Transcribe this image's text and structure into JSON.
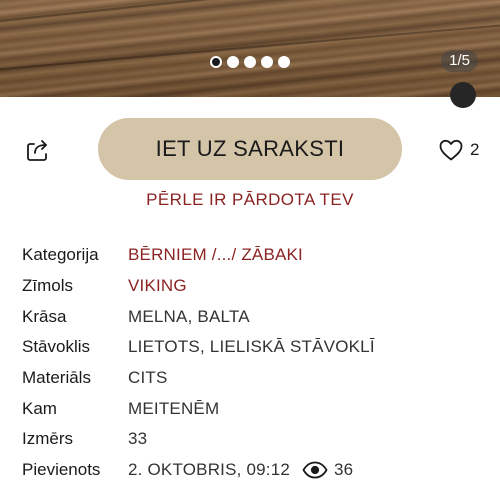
{
  "gallery": {
    "dots_total": 5,
    "active_index": 0,
    "counter": "1/5"
  },
  "actions": {
    "share_icon": "share-icon",
    "primary_label": "IET UZ SARAKSTI",
    "favorite_icon": "heart-icon",
    "favorite_count": "2"
  },
  "status": {
    "sold_note": "PĒRLE IR PĀRDOTA TEV"
  },
  "details": {
    "category": {
      "label": "Kategorija",
      "value": "BĒRNIEM /.../ ZĀBAKI"
    },
    "brand": {
      "label": "Zīmols",
      "value": "VIKING"
    },
    "color": {
      "label": "Krāsa",
      "value": "MELNA, BALTA"
    },
    "condition": {
      "label": "Stāvoklis",
      "value": "LIETOTS, LIELISKĀ STĀVOKLĪ"
    },
    "material": {
      "label": "Materiāls",
      "value": "CITS"
    },
    "audience": {
      "label": "Kam",
      "value": "MEITENĒM"
    },
    "size": {
      "label": "Izmērs",
      "value": "33"
    },
    "added": {
      "label": "Pievienots",
      "value": "2. OKTOBRIS, 09:12",
      "views_icon": "eye-icon",
      "views": "36"
    }
  },
  "colors": {
    "accent_red": "#8b2323",
    "button_beige": "#d4c4a8"
  }
}
